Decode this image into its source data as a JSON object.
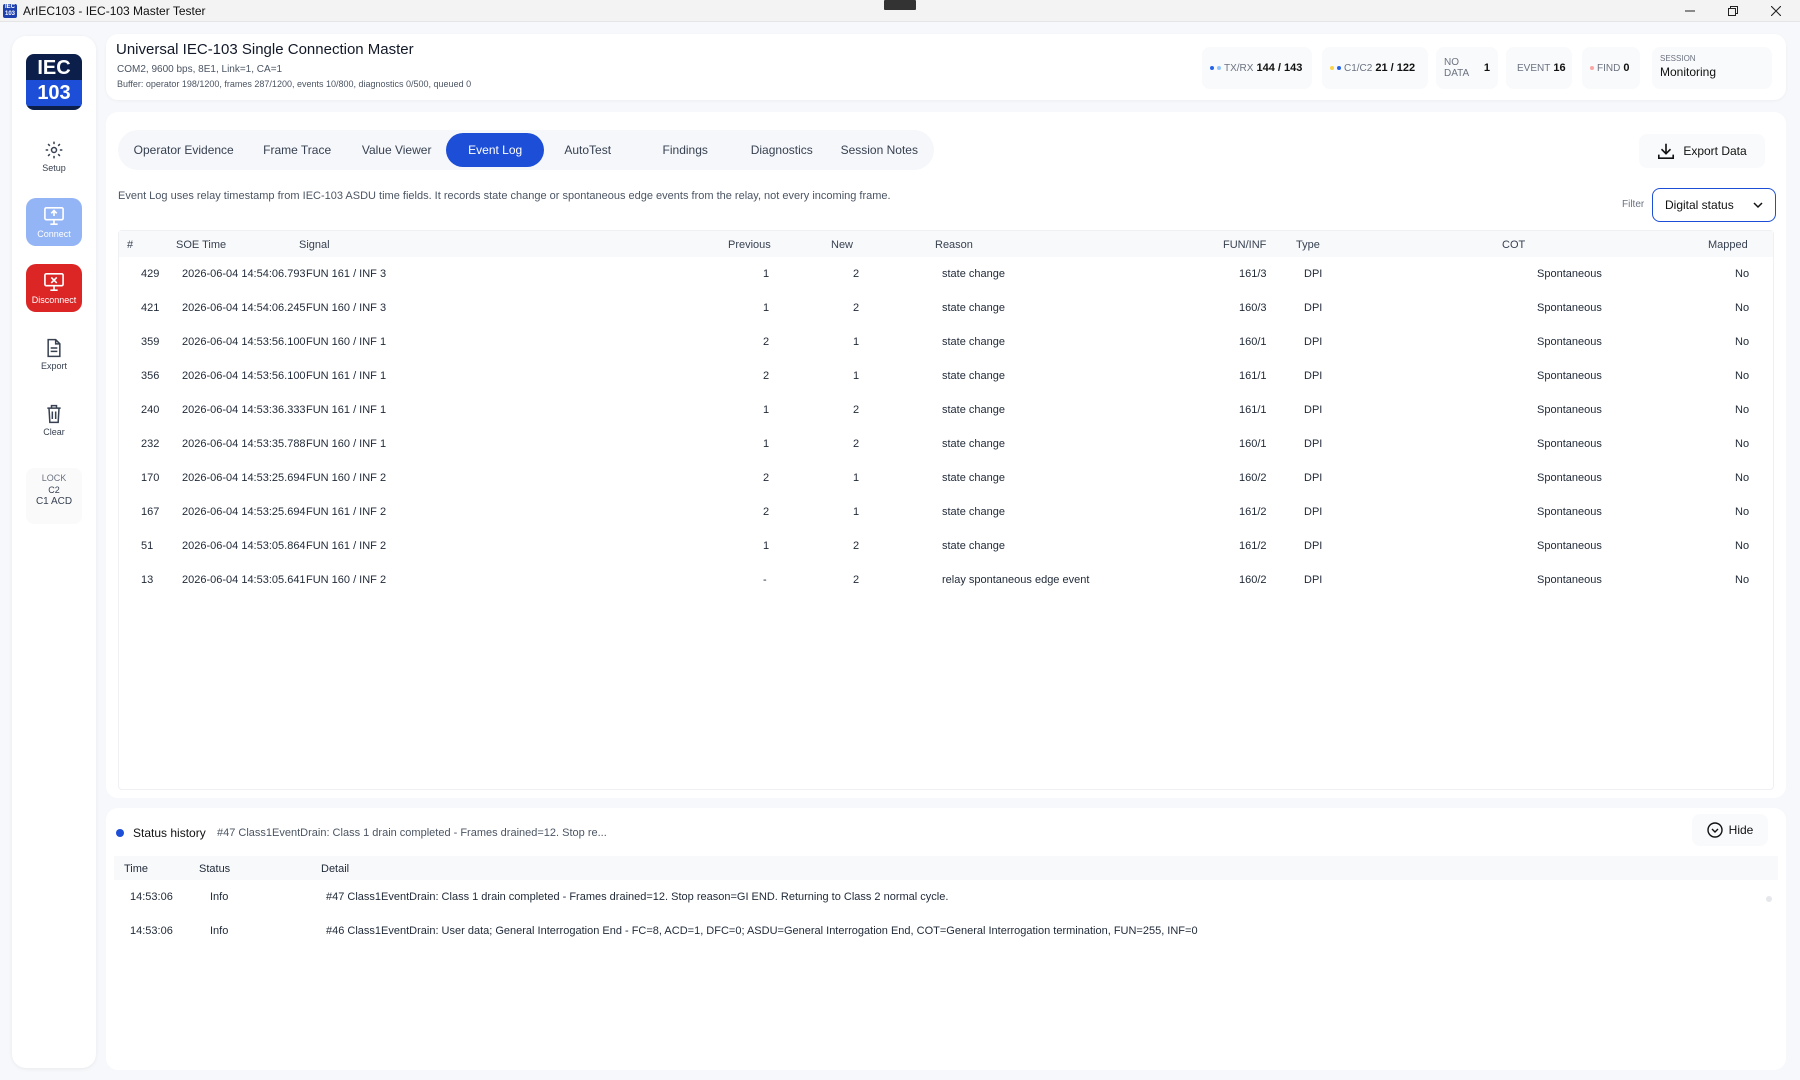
{
  "window": {
    "title": "ArIEC103 - IEC-103 Master Tester",
    "icon_text": "IEC 103"
  },
  "rail": {
    "logo_line1": "IEC",
    "logo_line2": "103",
    "setup": "Setup",
    "connect": "Connect",
    "disconnect": "Disconnect",
    "export": "Export",
    "clear": "Clear",
    "lock_title": "LOCK",
    "lock_line1": "C2",
    "lock_line2": "C1 ACD"
  },
  "header": {
    "title": "Universal IEC-103 Single Connection Master",
    "subtitle": "COM2, 9600 bps, 8E1, Link=1, CA=1",
    "buffer": "Buffer: operator 198/1200, frames 287/1200, events 10/800, diagnostics 0/500, queued 0",
    "txrx_label": "TX/RX",
    "txrx_value": "144 / 143",
    "c1c2_label": "C1/C2",
    "c1c2_value": "21 / 122",
    "nodata_label": "NO DATA",
    "nodata_value": "1",
    "event_label": "EVENT",
    "event_value": "16",
    "find_label": "FIND",
    "find_value": "0",
    "session_label": "SESSION",
    "session_value": "Monitoring"
  },
  "tabs": [
    {
      "label": "Operator Evidence"
    },
    {
      "label": "Frame Trace"
    },
    {
      "label": "Value Viewer"
    },
    {
      "label": "Event Log",
      "active": true
    },
    {
      "label": "AutoTest"
    },
    {
      "label": "Findings"
    },
    {
      "label": "Diagnostics"
    },
    {
      "label": "Session Notes"
    }
  ],
  "export_label": "Export Data",
  "info_text": "Event Log uses relay timestamp from IEC-103 ASDU time fields. It records state change or spontaneous edge events from the relay, not every incoming frame.",
  "filter": {
    "label": "Filter",
    "value": "Digital status"
  },
  "table": {
    "columns": [
      "#",
      "SOE Time",
      "Signal",
      "Previous",
      "New",
      "Reason",
      "FUN/INF",
      "Type",
      "COT",
      "Mapped"
    ],
    "rows": [
      [
        "429",
        "2026-06-04 14:54:06.793",
        "FUN 161 / INF 3",
        "1",
        "2",
        "state change",
        "161/3",
        "DPI",
        "Spontaneous",
        "No"
      ],
      [
        "421",
        "2026-06-04 14:54:06.245",
        "FUN 160 / INF 3",
        "1",
        "2",
        "state change",
        "160/3",
        "DPI",
        "Spontaneous",
        "No"
      ],
      [
        "359",
        "2026-06-04 14:53:56.100",
        "FUN 160 / INF 1",
        "2",
        "1",
        "state change",
        "160/1",
        "DPI",
        "Spontaneous",
        "No"
      ],
      [
        "356",
        "2026-06-04 14:53:56.100",
        "FUN 161 / INF 1",
        "2",
        "1",
        "state change",
        "161/1",
        "DPI",
        "Spontaneous",
        "No"
      ],
      [
        "240",
        "2026-06-04 14:53:36.333",
        "FUN 161 / INF 1",
        "1",
        "2",
        "state change",
        "161/1",
        "DPI",
        "Spontaneous",
        "No"
      ],
      [
        "232",
        "2026-06-04 14:53:35.788",
        "FUN 160 / INF 1",
        "1",
        "2",
        "state change",
        "160/1",
        "DPI",
        "Spontaneous",
        "No"
      ],
      [
        "170",
        "2026-06-04 14:53:25.694",
        "FUN 160 / INF 2",
        "2",
        "1",
        "state change",
        "160/2",
        "DPI",
        "Spontaneous",
        "No"
      ],
      [
        "167",
        "2026-06-04 14:53:25.694",
        "FUN 161 / INF 2",
        "2",
        "1",
        "state change",
        "161/2",
        "DPI",
        "Spontaneous",
        "No"
      ],
      [
        "51",
        "2026-06-04 14:53:05.864",
        "FUN 161 / INF 2",
        "1",
        "2",
        "state change",
        "161/2",
        "DPI",
        "Spontaneous",
        "No"
      ],
      [
        "13",
        "2026-06-04 14:53:05.641",
        "FUN 160 / INF 2",
        "-",
        "2",
        "relay spontaneous edge event",
        "160/2",
        "DPI",
        "Spontaneous",
        "No"
      ]
    ]
  },
  "status_history": {
    "title": "Status history",
    "last": "#47 Class1EventDrain: Class 1 drain completed - Frames drained=12. Stop re...",
    "hide_label": "Hide",
    "columns": [
      "Time",
      "Status",
      "Detail"
    ],
    "rows": [
      [
        "14:53:06",
        "Info",
        "#47 Class1EventDrain: Class 1 drain completed - Frames drained=12. Stop reason=GI END. Returning to Class 2 normal cycle."
      ],
      [
        "14:53:06",
        "Info",
        "#46 Class1EventDrain: User data; General Interrogation End - FC=8, ACD=1, DFC=0; ASDU=General Interrogation End, COT=General Interrogation termination, FUN=255, INF=0"
      ]
    ]
  },
  "colors": {
    "accent": "#1d4ed8",
    "danger": "#dc2626",
    "connect_disabled": "#93b4f5",
    "logo_bg": "#0b1f4a"
  }
}
